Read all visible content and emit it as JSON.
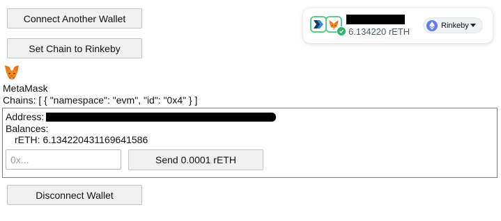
{
  "buttons": {
    "connect": "Connect Another Wallet",
    "set_chain": "Set Chain to Rinkeby",
    "send": "Send 0.0001 rETH",
    "disconnect": "Disconnect Wallet"
  },
  "wallet": {
    "name": "MetaMask",
    "icon": "metamask-fox-icon",
    "chains_text": "Chains: [ { \"namespace\": \"evm\", \"id\": \"0x4\" } ]",
    "address_label": "Address:",
    "balances_label": "Balances:",
    "balance_line": "rETH: 6.134220431169641586"
  },
  "send_form": {
    "placeholder": "0x..."
  },
  "account_widget": {
    "balance": "6.134220 rETH",
    "network": "Rinkeby",
    "connected_icon": "check-icon",
    "network_icon": "ethereum-icon",
    "colors": {
      "connected": "#2fb26a",
      "ethereum": "#627eea"
    }
  }
}
